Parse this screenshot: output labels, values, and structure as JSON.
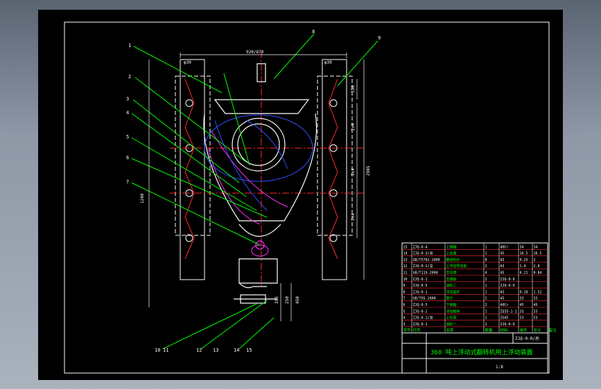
{
  "title_block": {
    "drawing_title": "360 吨上浮动式翻转机用上浮动装置",
    "drawing_number": "ZJQ-0-0/总",
    "scale": "1:8",
    "material": "",
    "sheet_labels": [
      "标记",
      "处数",
      "分区",
      "更改文件号",
      "签名",
      "年月日"
    ]
  },
  "parts_list": {
    "headers": [
      "序号",
      "代号",
      "名称",
      "数量",
      "材料",
      "单件",
      "总计",
      "备注"
    ],
    "rows": [
      {
        "no": "15",
        "code": "ZJQ-0-4",
        "name": "上销轴",
        "qty": "1",
        "mat": "40Cr",
        "unit": "34",
        "total": "34"
      },
      {
        "no": "14",
        "code": "ZJQ-0-3/总",
        "name": "上支座",
        "qty": "1",
        "mat": "45",
        "unit": "16.5",
        "total": "16.5"
      },
      {
        "no": "13",
        "code": "GB/T5782-2000",
        "name": "螺栓M20",
        "qty": "8",
        "mat": "A3",
        "unit": "0.25",
        "total": "2"
      },
      {
        "no": "12",
        "code": "ZJQ-0-2/总",
        "name": "上浮动导向板",
        "qty": "2",
        "mat": "A3",
        "unit": "1.4",
        "total": "2.8"
      },
      {
        "no": "11",
        "code": "GB/T119-2000",
        "name": "定位销",
        "qty": "4",
        "mat": "45",
        "unit": "0.21",
        "total": "0.84"
      },
      {
        "no": "10",
        "code": "ZJQ-0-1",
        "name": "支撑板",
        "qty": "2",
        "mat": "ZJQ-0-9",
        "unit": "",
        "total": ""
      },
      {
        "no": "9",
        "code": "ZJQ-0-5",
        "name": "油缸二",
        "qty": "1",
        "mat": "ZJQ-0-9",
        "unit": "",
        "total": ""
      },
      {
        "no": "8",
        "code": "ZJQ-0-1",
        "name": "浮动连杆",
        "qty": "1",
        "mat": "A3",
        "unit": "0.18",
        "total": "1.52"
      },
      {
        "no": "7",
        "code": "GB/T95-2000",
        "name": "垫片",
        "qty": "2",
        "mat": "45",
        "unit": "33",
        "total": "33"
      },
      {
        "no": "6",
        "code": "ZJQ-0-3",
        "name": "下销轴",
        "qty": "2",
        "mat": "40Cr",
        "unit": "45",
        "total": "45"
      },
      {
        "no": "5",
        "code": "ZJQ-0-2",
        "name": "浮动框体",
        "qty": "1",
        "mat": "ZQ35-1-1",
        "unit": "33",
        "total": "33"
      },
      {
        "no": "4",
        "code": "ZJQ-0-1/总",
        "name": "上托架",
        "qty": "1",
        "mat": "ZG45",
        "unit": "53",
        "total": "53"
      },
      {
        "no": "3",
        "code": "ZJQ-0-1",
        "name": "油缸一",
        "qty": "1",
        "mat": "ZJQ-0-9",
        "unit": "",
        "total": ""
      }
    ]
  },
  "balloons": [
    "1",
    "2",
    "3",
    "4",
    "5",
    "6",
    "7",
    "8",
    "9",
    "10",
    "11",
    "12",
    "13",
    "14",
    "15"
  ],
  "dims": {
    "top_overall": "920/870",
    "left_top": "φ30",
    "right_top": "φ30",
    "left_vertical": "1240",
    "right_vertical": "2985",
    "right_segment_1": "150",
    "right_segment_2": "2x4",
    "right_segment_3": "2x4",
    "right_segment_4": "2x4",
    "bottom_1": "355",
    "bottom_2": "250",
    "bottom_3": "450"
  },
  "colors": {
    "background": "#000000",
    "outline": "#ffffff",
    "centerline": "#ff2a2a",
    "leader": "#00ff00",
    "hidden": "#3050ff",
    "arc": "#ff30ff",
    "dim": "#ffffff"
  }
}
